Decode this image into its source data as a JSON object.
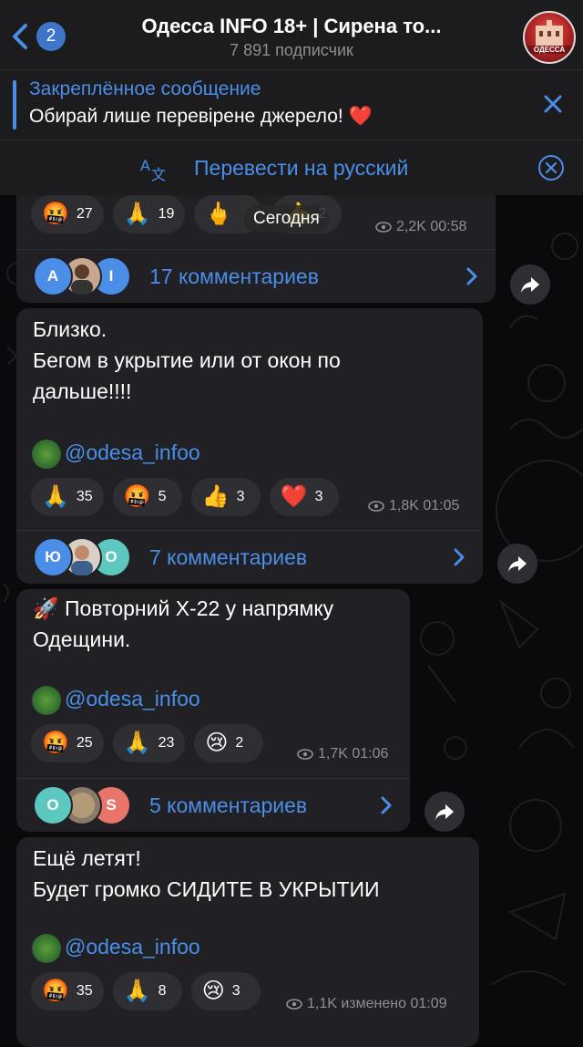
{
  "header": {
    "back_badge": "2",
    "title": "Одесса INFO 18+ | Сирена то...",
    "subtitle": "7 891 подписчик",
    "avatar_label": "ОДЕССА"
  },
  "pinned": {
    "title": "Закреплённое сообщение",
    "text": "Обирай лише перевірене джерело! ❤️"
  },
  "translate": {
    "label": "Перевести на русский"
  },
  "date_pill": "Сегодня",
  "messages": [
    {
      "reactions": [
        {
          "emoji": "🤬",
          "count": "27"
        },
        {
          "emoji": "🙏",
          "count": "19"
        },
        {
          "emoji": "🖕",
          "count": ""
        },
        {
          "emoji": "👍",
          "count": "2"
        }
      ],
      "views": "2,2K 00:58",
      "comments": {
        "label": "17 комментариев",
        "avatars": [
          "A",
          "",
          "I"
        ]
      }
    },
    {
      "text": [
        "Близко.",
        "Бегом в укрытие или от окон по",
        "дальше!!!!"
      ],
      "link": "@odesa_infoo",
      "reactions": [
        {
          "emoji": "🙏",
          "count": "35"
        },
        {
          "emoji": "🤬",
          "count": "5"
        },
        {
          "emoji": "👍",
          "count": "3"
        },
        {
          "emoji": "❤️",
          "count": "3"
        }
      ],
      "views": "1,8K 01:05",
      "comments": {
        "label": "7 комментариев",
        "avatars": [
          "Ю",
          "",
          "O"
        ]
      }
    },
    {
      "text": [
        "🚀 Повторний Х-22 у напрямку",
        "Одещини."
      ],
      "link": "@odesa_infoo",
      "reactions": [
        {
          "emoji": "🤬",
          "count": "25"
        },
        {
          "emoji": "🙏",
          "count": "23"
        },
        {
          "emoji": "😢",
          "count": "2"
        }
      ],
      "views": "1,7K 01:06",
      "comments": {
        "label": "5 комментариев",
        "avatars": [
          "O",
          "",
          "S"
        ]
      }
    },
    {
      "text": [
        "Ещё летят!",
        "Будет громко СИДИТЕ В УКРЫТИИ"
      ],
      "link": "@odesa_infoo",
      "reactions": [
        {
          "emoji": "🤬",
          "count": "35"
        },
        {
          "emoji": "🙏",
          "count": "8"
        },
        {
          "emoji": "😢",
          "count": "3"
        }
      ],
      "views": "1,1K изменено 01:09"
    }
  ],
  "colors": {
    "accent": "#4a8ee8",
    "bubble": "#212125",
    "header": "#1c1c1e"
  }
}
